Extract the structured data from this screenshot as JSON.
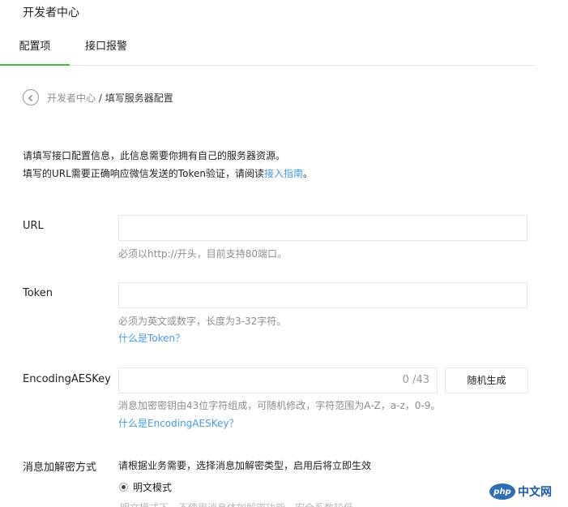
{
  "header": {
    "title": "开发者中心"
  },
  "tabs": [
    {
      "label": "配置项",
      "active": true
    },
    {
      "label": "接口报警",
      "active": false
    }
  ],
  "breadcrumb": {
    "parent": "开发者中心",
    "separator": " / ",
    "current": "填写服务器配置"
  },
  "intro": {
    "line1": "请填写接口配置信息，此信息需要你拥有自己的服务器资源。",
    "line2_prefix": "填写的URL需要正确响应微信发送的Token验证，请阅读",
    "line2_link": "接入指南",
    "line2_suffix": "。"
  },
  "form": {
    "url": {
      "label": "URL",
      "value": "",
      "hint": "必须以http://开头，目前支持80端口。"
    },
    "token": {
      "label": "Token",
      "value": "",
      "hint": "必须为英文或数字，长度为3-32字符。",
      "help_link": "什么是Token？"
    },
    "aes": {
      "label": "EncodingAESKey",
      "value": "",
      "counter": "0 /43",
      "generate_button": "随机生成",
      "hint": "消息加密密钥由43位字符组成，可随机修改，字符范围为A-Z，a-z，0-9。",
      "help_link": "什么是EncodingAESKey？"
    },
    "encryption": {
      "label": "消息加解密方式",
      "description": "请根据业务需要，选择消息加解密类型，启用后将立即生效",
      "option_plain": "明文模式",
      "option_plain_desc": "明文模式下，不使用消息体加解密功能，安全系数较低"
    }
  },
  "watermark": {
    "logo": "php",
    "text": "中文网"
  },
  "colors": {
    "accent": "#44b549",
    "link": "#459ae9",
    "border": "#e7e7eb",
    "hint": "#8d8d8d"
  }
}
